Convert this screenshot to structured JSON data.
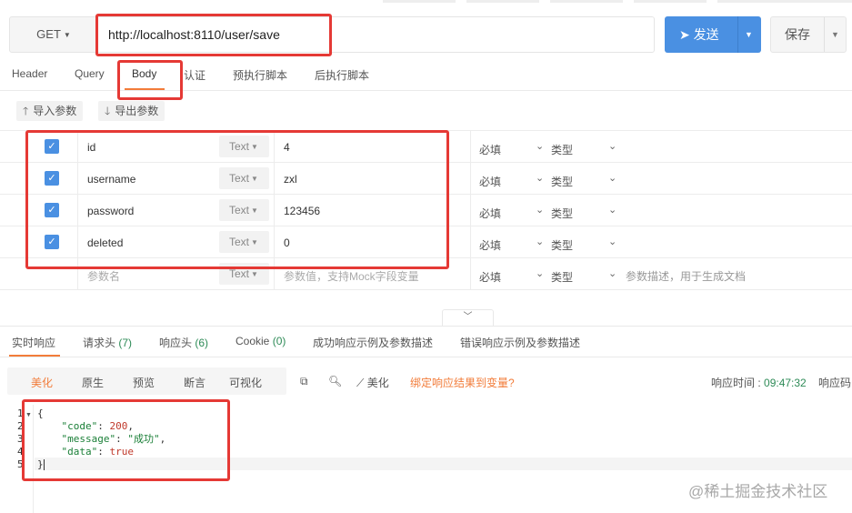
{
  "request": {
    "method": "GET",
    "url": "http://localhost:8110/user/save",
    "send_label": "发送",
    "save_label": "保存"
  },
  "tabs": [
    {
      "label": "Header"
    },
    {
      "label": "Query"
    },
    {
      "label": "Body",
      "active": true
    },
    {
      "label": "认证"
    },
    {
      "label": "预执行脚本"
    },
    {
      "label": "后执行脚本"
    }
  ],
  "params_toolbar": {
    "import_label": "导入参数",
    "export_label": "导出参数"
  },
  "params": [
    {
      "checked": true,
      "name": "id",
      "type": "Text",
      "value": "4",
      "required": "必填",
      "kind": "类型"
    },
    {
      "checked": true,
      "name": "username",
      "type": "Text",
      "value": "zxl",
      "required": "必填",
      "kind": "类型"
    },
    {
      "checked": true,
      "name": "password",
      "type": "Text",
      "value": "123456",
      "required": "必填",
      "kind": "类型"
    },
    {
      "checked": true,
      "name": "deleted",
      "type": "Text",
      "value": "0",
      "required": "必填",
      "kind": "类型"
    }
  ],
  "param_placeholder": {
    "name": "参数名",
    "type": "Text",
    "value": "参数值，支持Mock字段变量",
    "required": "必填",
    "kind": "类型",
    "desc": "参数描述，用于生成文档"
  },
  "response_tabs": [
    {
      "label": "实时响应",
      "active": true
    },
    {
      "label": "请求头",
      "count": "(7)"
    },
    {
      "label": "响应头",
      "count": "(6)"
    },
    {
      "label": "Cookie",
      "count": "(0)"
    },
    {
      "label": "成功响应示例及参数描述"
    },
    {
      "label": "错误响应示例及参数描述"
    }
  ],
  "format_buttons": [
    {
      "label": "美化",
      "active": true
    },
    {
      "label": "原生"
    },
    {
      "label": "预览"
    },
    {
      "label": "断言"
    },
    {
      "label": "可视化"
    }
  ],
  "toolbar": {
    "beautify_label": "美化",
    "bind_label": "绑定响应结果到变量?",
    "time_label": "响应时间 : ",
    "time_value": "09:47:32",
    "code_label": "响应码"
  },
  "response_body": {
    "line_numbers": [
      "1",
      "2",
      "3",
      "4",
      "5"
    ],
    "lines": [
      {
        "text": "{"
      },
      {
        "key": "\"code\"",
        "sep": ": ",
        "val": "200",
        "val_type": "number",
        "trail": ","
      },
      {
        "key": "\"message\"",
        "sep": ": ",
        "val": "\"成功\"",
        "val_type": "string",
        "trail": ","
      },
      {
        "key": "\"data\"",
        "sep": ": ",
        "val": "true",
        "val_type": "bool",
        "trail": ""
      },
      {
        "text": "}"
      }
    ]
  },
  "watermark": "@稀土掘金技术社区",
  "colors": {
    "primary": "#4a90e2",
    "accent": "#f27c3a",
    "highlight": "#e53935",
    "json_key": "#1a7f37",
    "json_number": "#c0392b"
  }
}
